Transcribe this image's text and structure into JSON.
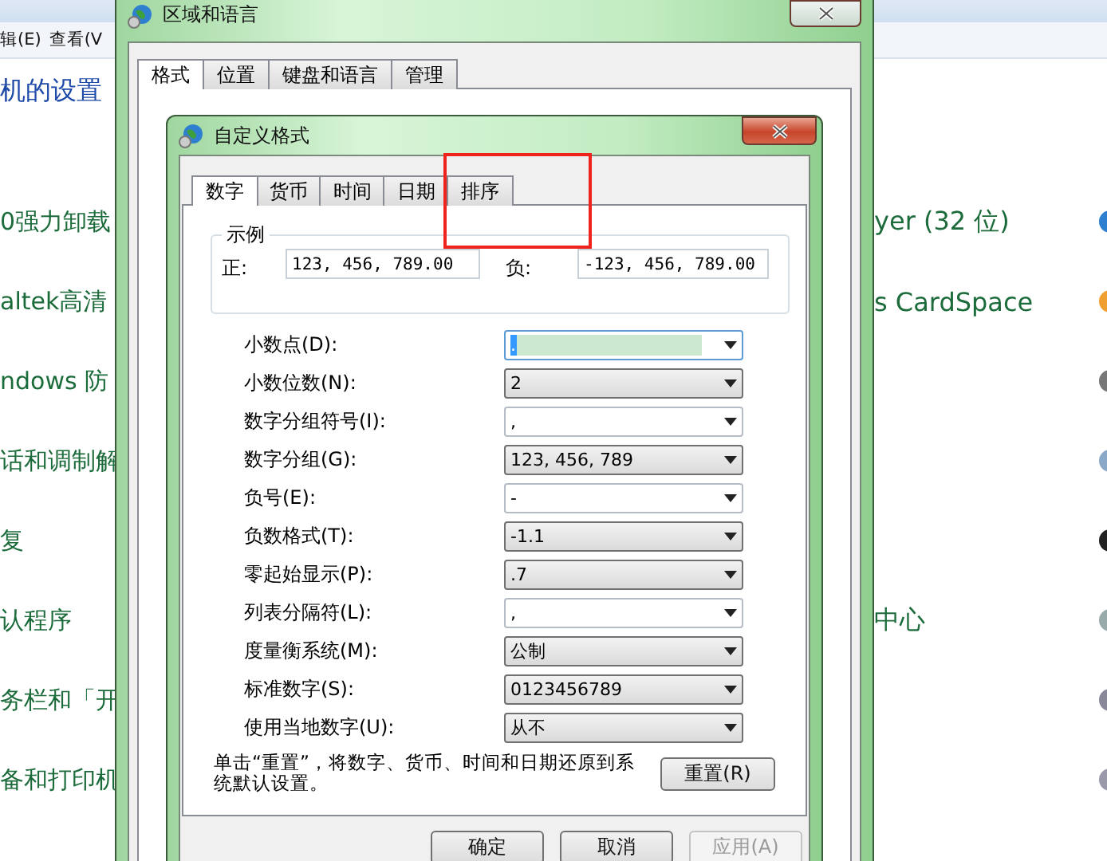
{
  "background_window": {
    "menu": [
      "辑(E)",
      "查看(V"
    ],
    "heading": "机的设置",
    "rows": [
      {
        "left": "0强力卸载",
        "right": "yer (32 位)"
      },
      {
        "left": "altek高清",
        "right": "s CardSpace"
      },
      {
        "left": "ndows 防"
      },
      {
        "left": "话和调制解"
      },
      {
        "left": "复"
      },
      {
        "left": "认程序",
        "right": "中心"
      },
      {
        "left": "务栏和「开"
      },
      {
        "left": "备和打印机"
      }
    ]
  },
  "region_dialog": {
    "title": "区域和语言",
    "tabs": [
      {
        "label": "格式",
        "selected": true
      },
      {
        "label": "位置",
        "selected": false
      },
      {
        "label": "键盘和语言",
        "selected": false
      },
      {
        "label": "管理",
        "selected": false
      }
    ]
  },
  "custom_format_dialog": {
    "title": "自定义格式",
    "tabs": [
      {
        "label": "数字",
        "selected": true,
        "highlighted": false
      },
      {
        "label": "货币",
        "selected": false,
        "highlighted": false
      },
      {
        "label": "时间",
        "selected": false,
        "highlighted": false
      },
      {
        "label": "日期",
        "selected": false,
        "highlighted": false
      },
      {
        "label": "排序",
        "selected": false,
        "highlighted": true
      }
    ],
    "sample": {
      "title": "示例",
      "positive_label": "正:",
      "positive_value": "123, 456, 789.00",
      "negative_label": "负:",
      "negative_value": "-123, 456, 789.00"
    },
    "settings": [
      {
        "label": "小数点(D):",
        "value": ".",
        "kind": "editable",
        "focused": true
      },
      {
        "label": "小数位数(N):",
        "value": "2",
        "kind": "list",
        "focused": false
      },
      {
        "label": "数字分组符号(I):",
        "value": ",",
        "kind": "editable",
        "focused": false
      },
      {
        "label": "数字分组(G):",
        "value": "123, 456, 789",
        "kind": "list",
        "focused": false
      },
      {
        "label": "负号(E):",
        "value": "-",
        "kind": "editable",
        "focused": false
      },
      {
        "label": "负数格式(T):",
        "value": "-1.1",
        "kind": "list",
        "focused": false
      },
      {
        "label": "零起始显示(P):",
        "value": ".7",
        "kind": "list",
        "focused": false
      },
      {
        "label": "列表分隔符(L):",
        "value": ",",
        "kind": "editable",
        "focused": false
      },
      {
        "label": "度量衡系统(M):",
        "value": "公制",
        "kind": "list",
        "focused": false
      },
      {
        "label": "标准数字(S):",
        "value": "0123456789",
        "kind": "list",
        "focused": false
      },
      {
        "label": "使用当地数字(U):",
        "value": "从不",
        "kind": "list",
        "focused": false
      }
    ],
    "note": "单击“重置”，将数字、货币、时间和日期还原到系统默认设置。",
    "reset_button": "重置(R)",
    "buttons": [
      {
        "label": "确定",
        "disabled": false
      },
      {
        "label": "取消",
        "disabled": false
      },
      {
        "label": "应用(A)",
        "disabled": true
      }
    ]
  }
}
